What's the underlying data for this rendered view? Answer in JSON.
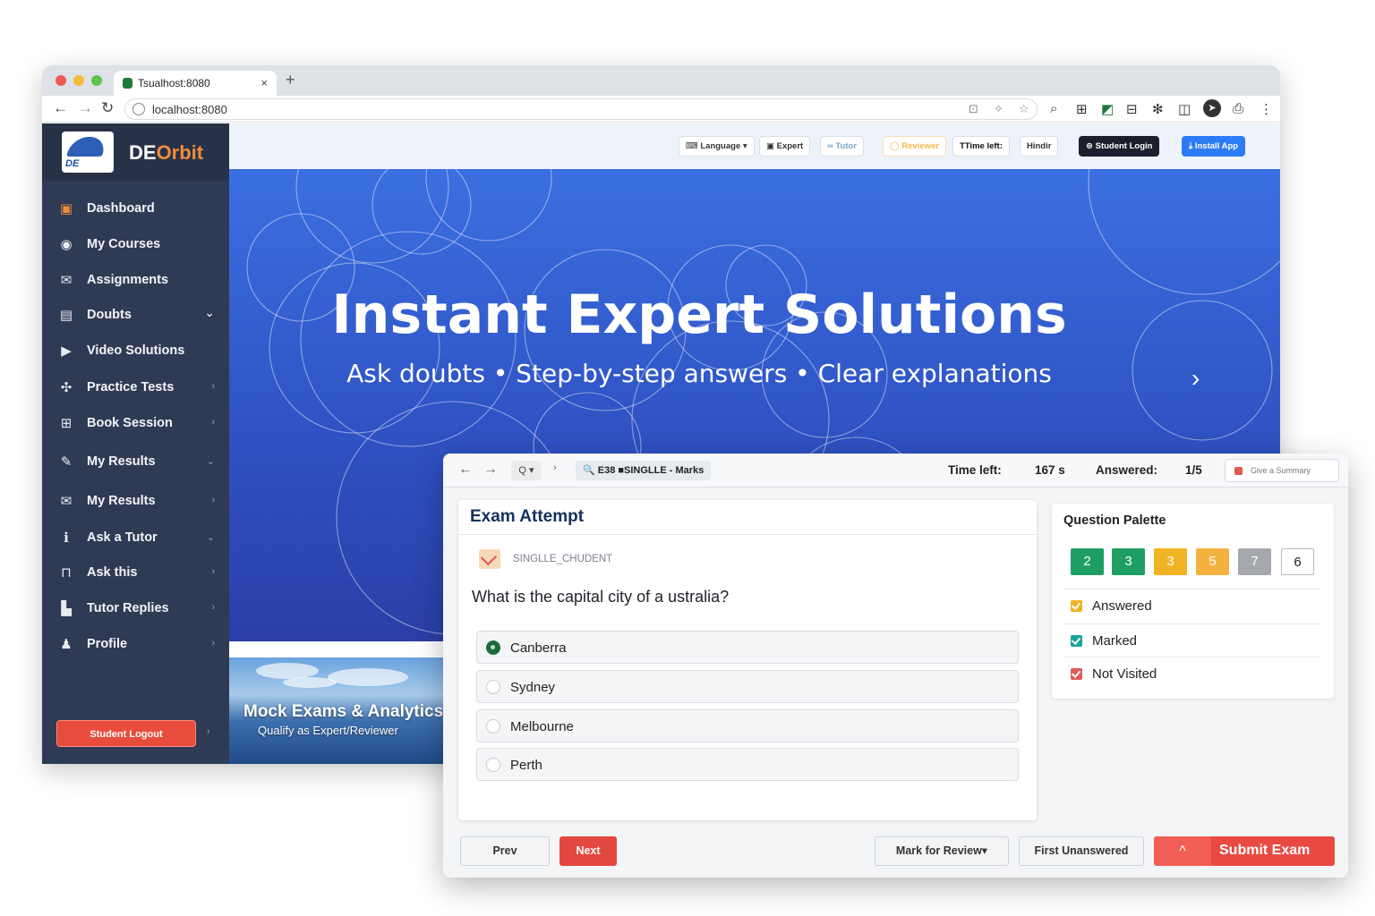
{
  "browser": {
    "tab_title": "Tsualhost:8080",
    "tab_close": "×",
    "new_tab": "+",
    "url": "localhost:8080",
    "nav_back": "←",
    "nav_forward": "→",
    "nav_reload": "↻"
  },
  "brand": {
    "prefix": "DE",
    "suffix": "Orbit",
    "logo_word": "DE",
    "accent": "#f28b3c"
  },
  "sidebar": {
    "items": [
      {
        "label": "Dashboard",
        "icon": "dashboard-icon",
        "glyph": "▣",
        "chevron": ""
      },
      {
        "label": "My Courses",
        "icon": "courses-icon",
        "glyph": "◉",
        "chevron": ""
      },
      {
        "label": "Assignments",
        "icon": "mail-icon",
        "glyph": "✉",
        "chevron": ""
      },
      {
        "label": "Doubts",
        "icon": "doubts-icon",
        "glyph": "▤",
        "chevron": "⌄"
      },
      {
        "label": "Video Solutions",
        "icon": "video-icon",
        "glyph": "▶",
        "chevron": ""
      },
      {
        "label": "Practice Tests",
        "icon": "tests-icon",
        "glyph": "✣",
        "chevron": "›"
      },
      {
        "label": "Book Session",
        "icon": "gift-icon",
        "glyph": "⊞",
        "chevron": "›"
      },
      {
        "label": "My Results",
        "icon": "results-icon",
        "glyph": "✎",
        "chevron": "⌄"
      },
      {
        "label": "My Results",
        "icon": "envelope-icon",
        "glyph": "✉",
        "chevron": "›"
      },
      {
        "label": "Ask a Tutor",
        "icon": "info-icon",
        "glyph": "ℹ",
        "chevron": "⌄"
      },
      {
        "label": "Ask this",
        "icon": "lock-icon",
        "glyph": "⊓",
        "chevron": "›"
      },
      {
        "label": "Tutor Replies",
        "icon": "replies-icon",
        "glyph": "▙",
        "chevron": "›"
      },
      {
        "label": "Profile",
        "icon": "profile-icon",
        "glyph": "♟",
        "chevron": "›"
      }
    ],
    "logout_label": "Student Logout",
    "logout_chevron": "›"
  },
  "topnav": {
    "language": "Language ▾",
    "expert": "Expert",
    "tutor": "Tutor",
    "reviewer": "Reviewer",
    "time_left": "TTime left:",
    "hindi": "Hindir",
    "student_login": "Student Login",
    "install_app": "Install App"
  },
  "hero": {
    "title": "Instant Expert Solutions",
    "subtitle": "Ask doubts • Step-by-step answers • Clear explanations",
    "next_arrow": "›"
  },
  "thumb": {
    "title": "Mock Exams & Analytics",
    "subtitle": "Qualify as Expert/Reviewer"
  },
  "exam_bar": {
    "search": "Q",
    "tab_label": "E38 ■SINGLLE - Marks",
    "time_label": "Time left:",
    "time_value": "167 s",
    "answered_label": "Answered:",
    "answered_value": "1/5",
    "button_label": "Give a Summary"
  },
  "exam": {
    "title": "Exam Attempt",
    "user": "SINGLLE_CHUDENT",
    "question": "What is the capital city of a ustralia?",
    "options": [
      {
        "label": "Canberra",
        "selected": true
      },
      {
        "label": "Sydney",
        "selected": false
      },
      {
        "label": "Melbourne",
        "selected": false
      },
      {
        "label": "Perth",
        "selected": false
      }
    ]
  },
  "palette": {
    "title": "Question Palette",
    "cells": [
      {
        "num": "2",
        "color": "#1e9e63"
      },
      {
        "num": "3",
        "color": "#1e9e63"
      },
      {
        "num": "3",
        "color": "#f0b323"
      },
      {
        "num": "5",
        "color": "#f3b23f"
      },
      {
        "num": "7",
        "color": "#a5a8ad"
      },
      {
        "num": "6",
        "color": "#ffffff"
      }
    ],
    "legend": [
      {
        "label": "Answered",
        "color": "#f0b323"
      },
      {
        "label": "Marked",
        "color": "#1aa39a"
      },
      {
        "label": "Not Visited",
        "color": "#e35a5a"
      }
    ]
  },
  "footer": {
    "prev": "Prev",
    "next": "Next",
    "mark_review": "Mark for Review▾",
    "first_unanswered": "First Unanswered",
    "submit": "Submit Exam",
    "submit_icon": "^"
  }
}
